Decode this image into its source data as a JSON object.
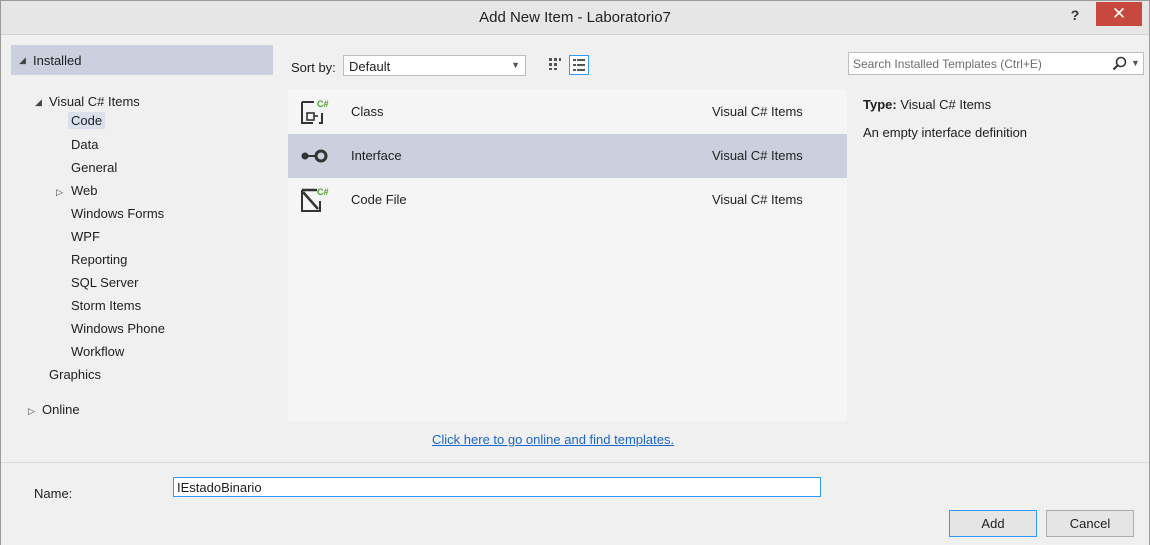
{
  "window": {
    "title": "Add New Item - Laboratorio7",
    "help_label": "?",
    "close_label": "✕"
  },
  "left": {
    "installed_label": "Installed",
    "tree": {
      "root_label": "Visual C# Items",
      "items": [
        "Code",
        "Data",
        "General",
        "Web",
        "Windows Forms",
        "WPF",
        "Reporting",
        "SQL Server",
        "Storm Items",
        "Windows Phone",
        "Workflow"
      ],
      "selected": "Code",
      "graphics_label": "Graphics",
      "online_label": "Online"
    }
  },
  "center": {
    "sort_label": "Sort by:",
    "sort_value": "Default",
    "templates": [
      {
        "name": "Class",
        "category": "Visual C# Items",
        "icon": "class-icon"
      },
      {
        "name": "Interface",
        "category": "Visual C# Items",
        "icon": "interface-icon"
      },
      {
        "name": "Code File",
        "category": "Visual C# Items",
        "icon": "code-file-icon"
      }
    ],
    "selected_template": "Interface",
    "online_link": "Click here to go online and find templates."
  },
  "right": {
    "search_placeholder": "Search Installed Templates (Ctrl+E)",
    "type_label": "Type:",
    "type_value": "Visual C# Items",
    "description": "An empty interface definition"
  },
  "bottom": {
    "name_label": "Name:",
    "name_value": "IEstadoBinario",
    "add_label": "Add",
    "cancel_label": "Cancel"
  },
  "colors": {
    "accent": "#3399ff",
    "selection": "#cbd0de",
    "close": "#c7483e",
    "link": "#1a66c9"
  }
}
